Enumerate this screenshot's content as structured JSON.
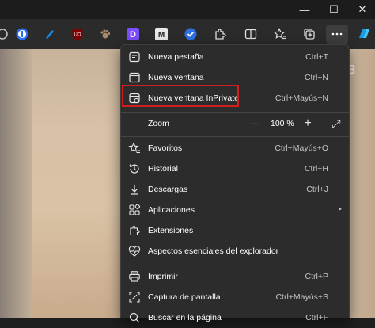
{
  "colors": {
    "menu_bg": "#2c2c2c",
    "highlight": "#d01f1f",
    "toolbar_bg": "#2b2b2b",
    "page_bg": "#d8c1a6"
  },
  "window": {
    "minimize_glyph": "—",
    "maximize_glyph": "☐",
    "close_glyph": "✕"
  },
  "toolbar": {
    "extensions": [
      {
        "name": "one-password-icon",
        "label": "1"
      },
      {
        "name": "pen-icon",
        "label": ""
      },
      {
        "name": "ublock-icon",
        "label": "UO"
      },
      {
        "name": "paw-icon",
        "label": ""
      },
      {
        "name": "d-icon",
        "label": "D"
      },
      {
        "name": "m-icon",
        "label": "M"
      },
      {
        "name": "shield-check-icon",
        "label": ""
      },
      {
        "name": "puzzle-icon",
        "label": ""
      },
      {
        "name": "split-screen-icon",
        "label": ""
      },
      {
        "name": "favorites-icon",
        "label": ""
      },
      {
        "name": "collections-icon",
        "label": ""
      },
      {
        "name": "more-icon",
        "label": "···"
      },
      {
        "name": "copilot-icon",
        "label": ""
      }
    ]
  },
  "page": {
    "corner_glyph": "3"
  },
  "menu": {
    "items": [
      {
        "label": "Nueva pestaña",
        "shortcut": "Ctrl+T",
        "icon": "new-tab-icon"
      },
      {
        "label": "Nueva ventana",
        "shortcut": "Ctrl+N",
        "icon": "new-window-icon"
      },
      {
        "label": "Nueva ventana InPrivate",
        "shortcut": "Ctrl+Mayús+N",
        "icon": "inprivate-icon"
      },
      {
        "label": "Zoom",
        "icon": "zoom"
      },
      {
        "label": "Favoritos",
        "shortcut": "Ctrl+Mayús+O",
        "icon": "star-icon"
      },
      {
        "label": "Historial",
        "shortcut": "Ctrl+H",
        "icon": "history-icon"
      },
      {
        "label": "Descargas",
        "shortcut": "Ctrl+J",
        "icon": "download-icon"
      },
      {
        "label": "Aplicaciones",
        "shortcut": "",
        "icon": "apps-icon"
      },
      {
        "label": "Extensiones",
        "shortcut": "",
        "icon": "puzzle-icon"
      },
      {
        "label": "Aspectos esenciales del explorador",
        "shortcut": "",
        "icon": "heart-pulse-icon"
      },
      {
        "label": "Imprimir",
        "shortcut": "Ctrl+P",
        "icon": "print-icon"
      },
      {
        "label": "Captura de pantalla",
        "shortcut": "Ctrl+Mayús+S",
        "icon": "screenshot-icon"
      },
      {
        "label": "Buscar en la página",
        "shortcut": "Ctrl+F",
        "icon": "search-icon"
      }
    ],
    "zoom": {
      "minus": "—",
      "value": "100 %",
      "plus": "+",
      "fullscreen": "⤢"
    },
    "submenu_arrow": "▸"
  }
}
